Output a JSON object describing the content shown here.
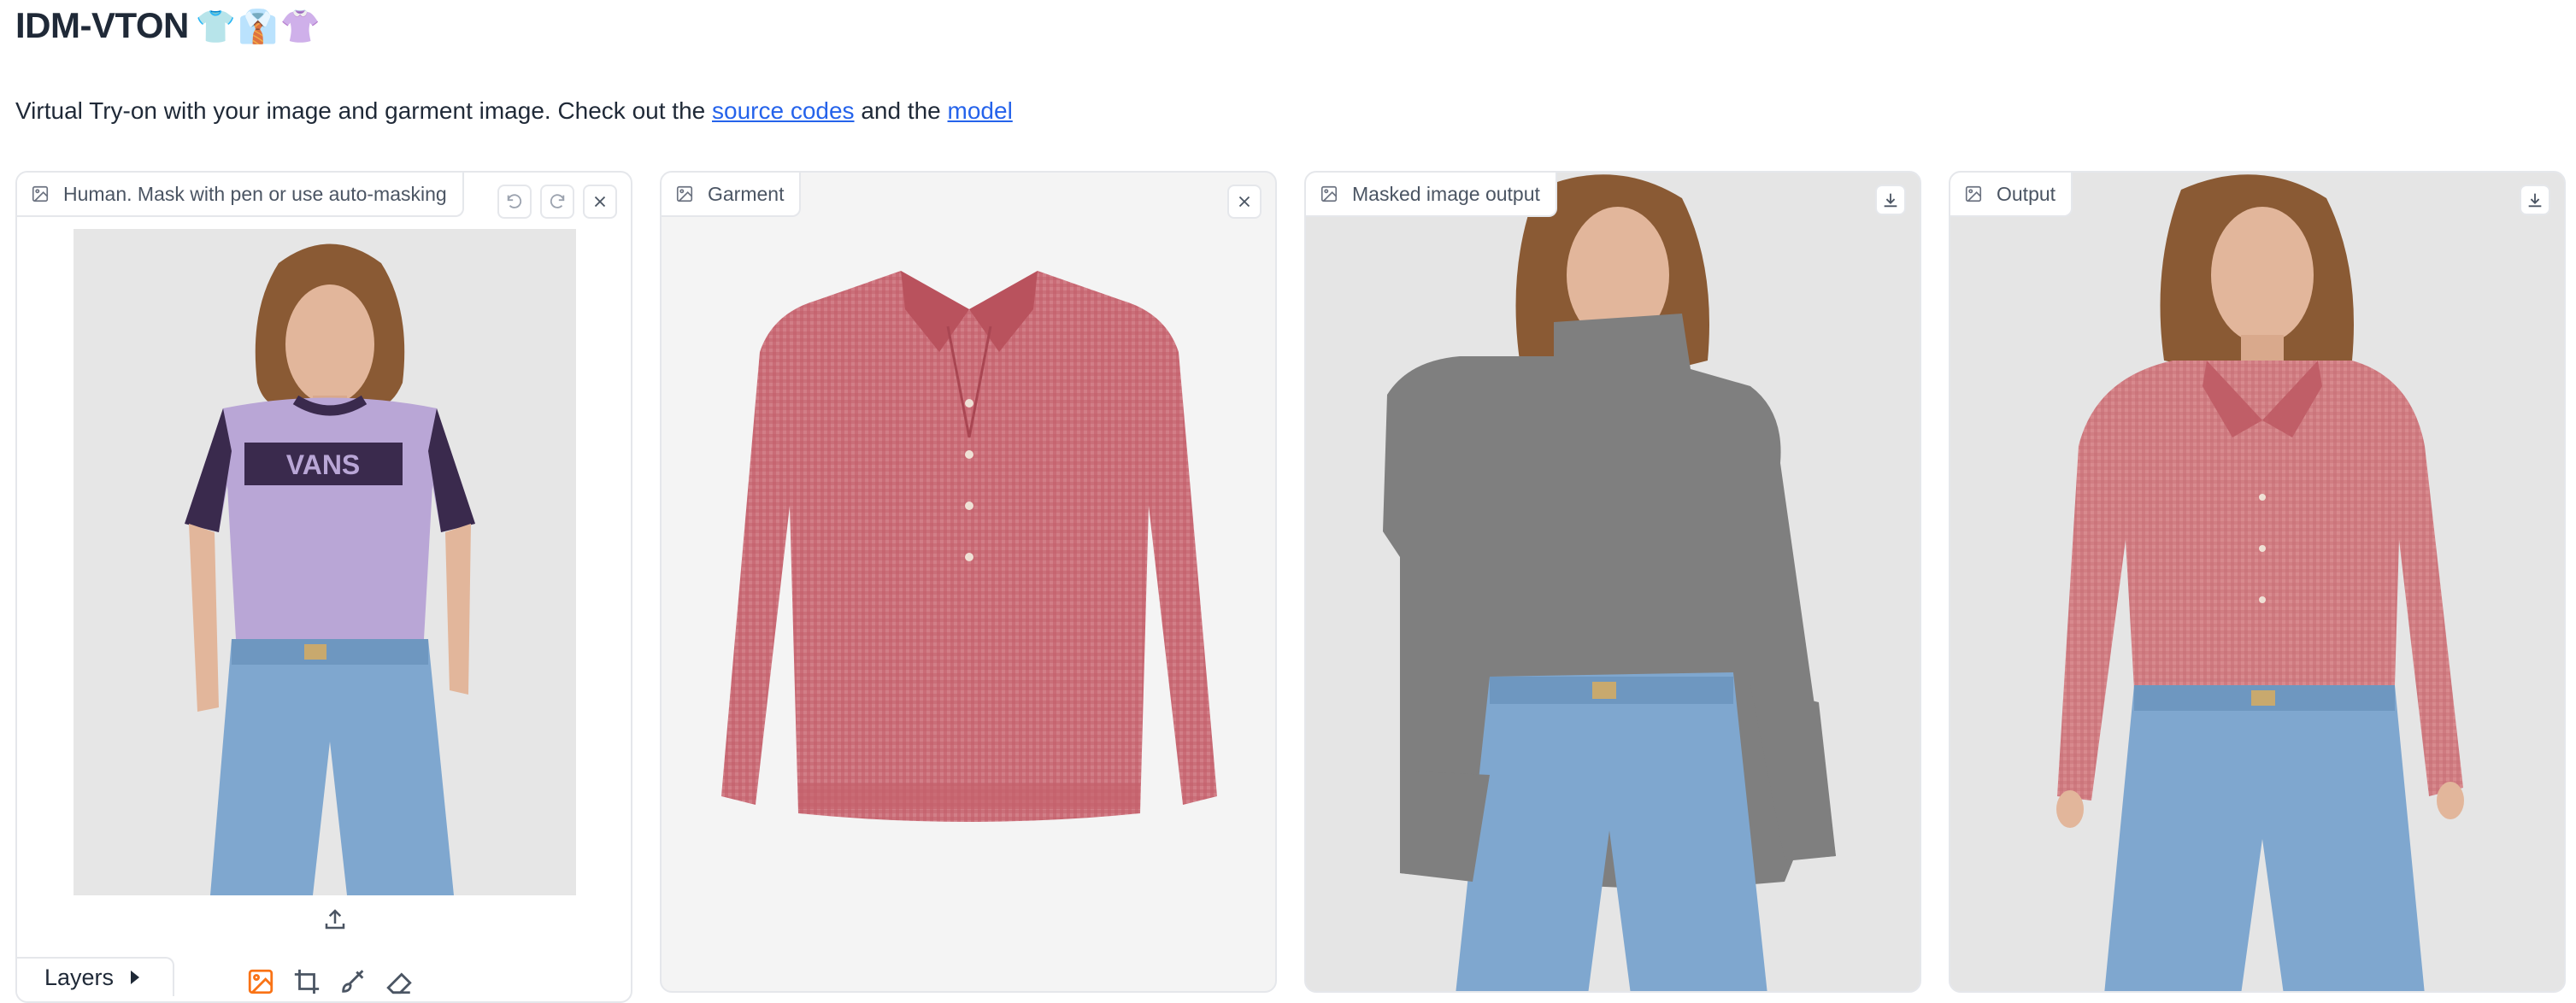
{
  "header": {
    "title": "IDM-VTON",
    "emoji": "👕👔👚"
  },
  "description": {
    "text_before": "Virtual Try-on with your image and garment image. Check out the ",
    "link1": "source codes",
    "text_middle": " and the ",
    "link2": "model"
  },
  "panels": {
    "human": {
      "label": "Human. Mask with pen or use auto-masking",
      "icon": "image-icon"
    },
    "garment": {
      "label": "Garment",
      "icon": "image-icon"
    },
    "masked": {
      "label": "Masked image output",
      "icon": "image-icon"
    },
    "output": {
      "label": "Output",
      "icon": "image-icon"
    }
  },
  "editor": {
    "layers_label": "Layers",
    "tools": [
      "image-tool-icon",
      "crop-icon",
      "brush-icon",
      "eraser-icon"
    ],
    "buttons": [
      "undo-icon",
      "redo-icon",
      "close-icon",
      "upload-icon"
    ]
  },
  "colors": {
    "link": "#2563eb",
    "accent": "#f97316",
    "mask_gray": "#7f7f7f",
    "garment_pink": "#c9636e",
    "tshirt_lavender": "#b9a6d6",
    "tshirt_dark": "#3a2a4d",
    "denim": "#7fa7cf"
  }
}
